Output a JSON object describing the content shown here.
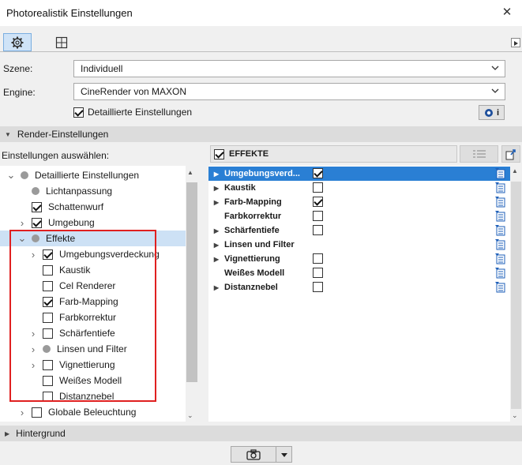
{
  "window": {
    "title": "Photorealistik Einstellungen"
  },
  "form": {
    "szene_label": "Szene:",
    "szene_value": "Individuell",
    "engine_label": "Engine:",
    "engine_value": "CineRender von MAXON",
    "detail_checkbox_label": "Detaillierte Einstellungen",
    "detail_checked": true
  },
  "sections": {
    "render": "Render-Einstellungen",
    "hintergrund": "Hintergrund"
  },
  "tree": {
    "heading": "Einstellungen auswählen:",
    "items": [
      {
        "label": "Detaillierte Einstellungen",
        "indent": 0,
        "expander": "open",
        "mark": "dot"
      },
      {
        "label": "Lichtanpassung",
        "indent": 1,
        "expander": "none",
        "mark": "dot"
      },
      {
        "label": "Schattenwurf",
        "indent": 1,
        "expander": "none",
        "mark": "checked"
      },
      {
        "label": "Umgebung",
        "indent": 1,
        "expander": "closed",
        "mark": "checked"
      },
      {
        "label": "Effekte",
        "indent": 1,
        "expander": "open",
        "mark": "dot",
        "selected": true
      },
      {
        "label": "Umgebungsverdeckung",
        "indent": 2,
        "expander": "closed",
        "mark": "checked"
      },
      {
        "label": "Kaustik",
        "indent": 2,
        "expander": "none",
        "mark": "unchecked"
      },
      {
        "label": "Cel Renderer",
        "indent": 2,
        "expander": "none",
        "mark": "unchecked"
      },
      {
        "label": "Farb-Mapping",
        "indent": 2,
        "expander": "none",
        "mark": "checked"
      },
      {
        "label": "Farbkorrektur",
        "indent": 2,
        "expander": "none",
        "mark": "unchecked"
      },
      {
        "label": "Schärfentiefe",
        "indent": 2,
        "expander": "closed",
        "mark": "unchecked"
      },
      {
        "label": "Linsen und Filter",
        "indent": 2,
        "expander": "closed",
        "mark": "dot"
      },
      {
        "label": "Vignettierung",
        "indent": 2,
        "expander": "closed",
        "mark": "unchecked"
      },
      {
        "label": "Weißes Modell",
        "indent": 2,
        "expander": "none",
        "mark": "unchecked"
      },
      {
        "label": "Distanznebel",
        "indent": 2,
        "expander": "none",
        "mark": "unchecked"
      },
      {
        "label": "Globale Beleuchtung",
        "indent": 1,
        "expander": "closed",
        "mark": "unchecked"
      }
    ]
  },
  "panel": {
    "header": "EFFEKTE",
    "header_checked": true,
    "rows": [
      {
        "label": "Umgebungsverd...",
        "expander": true,
        "checkbox": "checked",
        "selected": true
      },
      {
        "label": "Kaustik",
        "expander": true,
        "checkbox": "unchecked"
      },
      {
        "label": "Farb-Mapping",
        "expander": true,
        "checkbox": "checked"
      },
      {
        "label": "Farbkorrektur",
        "expander": false,
        "checkbox": "unchecked"
      },
      {
        "label": "Schärfentiefe",
        "expander": true,
        "checkbox": "unchecked"
      },
      {
        "label": "Linsen und Filter",
        "expander": true,
        "checkbox": "none"
      },
      {
        "label": "Vignettierung",
        "expander": true,
        "checkbox": "unchecked"
      },
      {
        "label": "Weißes Modell",
        "expander": false,
        "checkbox": "unchecked"
      },
      {
        "label": "Distanznebel",
        "expander": true,
        "checkbox": "unchecked"
      }
    ]
  },
  "colors": {
    "selection": "#2a7fd4",
    "tree_selection": "#cde1f5",
    "highlight_box": "#e02020"
  }
}
